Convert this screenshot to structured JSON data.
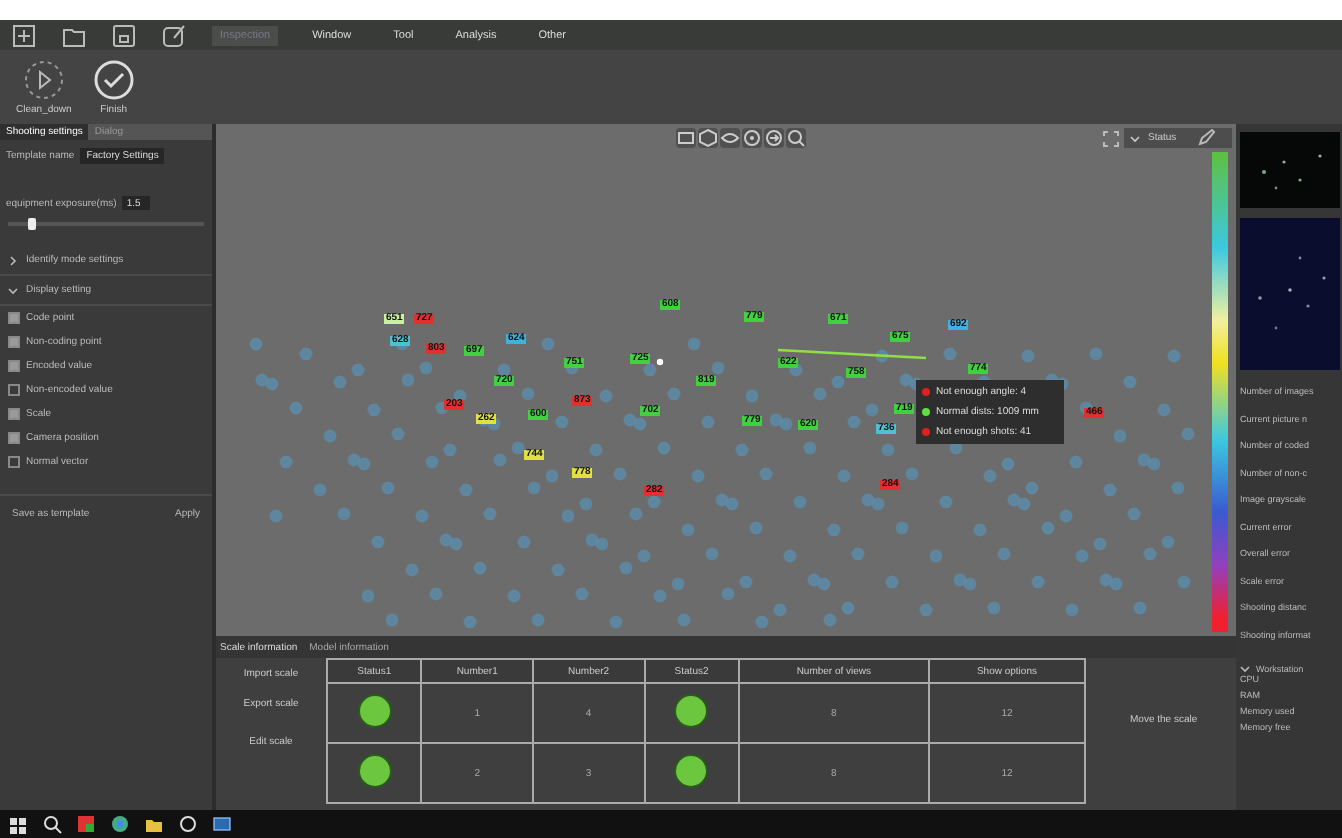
{
  "menu": [
    {
      "label": "Inspection",
      "selected": true
    },
    {
      "label": "Window",
      "selected": false
    },
    {
      "label": "Tool",
      "selected": false
    },
    {
      "label": "Analysis",
      "selected": false
    },
    {
      "label": "Other",
      "selected": false
    }
  ],
  "toolbar": [
    {
      "label": "Clean_down",
      "kind": "clean"
    },
    {
      "label": "Finish",
      "kind": "finish"
    }
  ],
  "left_panel": {
    "tabs": [
      {
        "label": "Shooting settings",
        "selected": true
      },
      {
        "label": "Dialog",
        "selected": false
      }
    ],
    "template_label": "Template name",
    "template_value": "Factory Settings",
    "exposure_label": "equipment exposure(ms)",
    "exposure_value": "1.5",
    "exposure": {
      "level": 0.12
    },
    "sections": [
      {
        "label": "Identify mode settings",
        "expanded": false
      },
      {
        "label": "Display setting",
        "expanded": true
      }
    ],
    "options": [
      {
        "label": "Code point",
        "checked": true
      },
      {
        "label": "Non-coding point",
        "checked": true
      },
      {
        "label": "Encoded value",
        "checked": true
      },
      {
        "label": "Non-encoded value",
        "checked": false
      },
      {
        "label": "Scale",
        "checked": true
      },
      {
        "label": "Camera position",
        "checked": true
      },
      {
        "label": "Normal vector",
        "checked": false
      }
    ],
    "save_template": "Save as template",
    "apply": "Apply"
  },
  "viewport": {
    "status_filter": "Status",
    "point_labels": [
      {
        "text": "651",
        "color": "#c8f0a0"
      },
      {
        "text": "727",
        "color": "#e03030"
      },
      {
        "text": "628",
        "color": "#50c0d0"
      },
      {
        "text": "624",
        "color": "#40b0e0"
      },
      {
        "text": "697",
        "color": "#40d040"
      },
      {
        "text": "803",
        "color": "#e03030"
      },
      {
        "text": "608",
        "color": "#40d040"
      },
      {
        "text": "779",
        "color": "#40d040"
      },
      {
        "text": "671",
        "color": "#40d040"
      },
      {
        "text": "675",
        "color": "#40d040"
      },
      {
        "text": "692",
        "color": "#40b0e0"
      },
      {
        "text": "751",
        "color": "#40d040"
      },
      {
        "text": "725",
        "color": "#40d040"
      },
      {
        "text": "720",
        "color": "#40d040"
      },
      {
        "text": "622",
        "color": "#40d040"
      },
      {
        "text": "758",
        "color": "#40d040"
      },
      {
        "text": "774",
        "color": "#40d040"
      },
      {
        "text": "819",
        "color": "#40d040"
      },
      {
        "text": "203",
        "color": "#e03030"
      },
      {
        "text": "873",
        "color": "#e03030"
      },
      {
        "text": "262",
        "color": "#e0e040"
      },
      {
        "text": "600",
        "color": "#40d040"
      },
      {
        "text": "702",
        "color": "#40d040"
      },
      {
        "text": "779",
        "color": "#40d040"
      },
      {
        "text": "620",
        "color": "#40d040"
      },
      {
        "text": "719",
        "color": "#40d040"
      },
      {
        "text": "736",
        "color": "#50c0d0"
      },
      {
        "text": "744",
        "color": "#e0e040"
      },
      {
        "text": "778",
        "color": "#e0e040"
      },
      {
        "text": "282",
        "color": "#e03030"
      },
      {
        "text": "284",
        "color": "#e03030"
      },
      {
        "text": "466",
        "color": "#e03030"
      }
    ],
    "tooltip": [
      {
        "text": "Not enough angle: 4",
        "color": "#e02020"
      },
      {
        "text": "Normal dists: 1009 mm",
        "color": "#60e040"
      },
      {
        "text": "Not enough shots: 41",
        "color": "#e02020"
      }
    ]
  },
  "bottom_panel": {
    "tabs": [
      {
        "label": "Scale information",
        "selected": true
      },
      {
        "label": "Model information",
        "selected": false
      }
    ],
    "actions": [
      "Import scale",
      "Export scale",
      "Edit scale"
    ],
    "columns": [
      "Status1",
      "Number1",
      "Number2",
      "Status2",
      "Number of views",
      "Show options"
    ],
    "rows": [
      {
        "status1": true,
        "number1": "1",
        "number2": "4",
        "status2": true,
        "views": "8",
        "options": "12"
      },
      {
        "status1": true,
        "number1": "2",
        "number2": "3",
        "status2": true,
        "views": "8",
        "options": "12"
      }
    ],
    "move_scale": "Move the scale"
  },
  "right_panel": {
    "stats": [
      "Number of images",
      "Current picture n",
      "Number of coded",
      "Number of non-c",
      "Image grayscale",
      "Current error",
      "Overall error",
      "Scale error",
      "Shooting distanc",
      "Shooting informat"
    ],
    "workstation": {
      "label": "Workstation",
      "expanded": true,
      "items": [
        "CPU",
        "RAM",
        "Memory used",
        "Memory free"
      ]
    }
  }
}
